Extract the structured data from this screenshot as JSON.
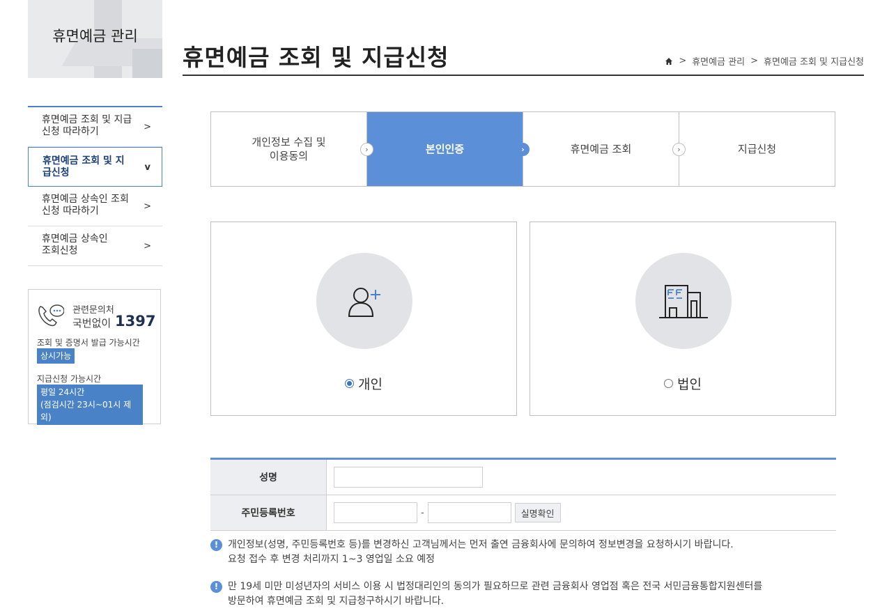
{
  "sidebar": {
    "title": "휴면예금 관리",
    "items": [
      {
        "label": "휴면예금 조회 및 지급신청 따라하기",
        "arrow": ">"
      },
      {
        "label": "휴면예금 조회 및 지급신청",
        "arrow": "v"
      },
      {
        "label": "휴면예금 상속인 조회신청 따라하기",
        "arrow": ">"
      },
      {
        "label": "휴면예금 상속인 조회신청",
        "arrow": ">"
      }
    ],
    "contact": {
      "label": "관련문의처",
      "prefix": "국번없이",
      "number": "1397",
      "hours1_label": "조회 및 증명서 발급 가능시간",
      "hours1_badge": "상시가능",
      "hours2_label": "지급신청 가능시간",
      "hours2_badge_line1": "평일 24시간",
      "hours2_badge_line2": "(점검시간 23시~01시 제외)"
    }
  },
  "header": {
    "title": "휴면예금 조회 및 지급신청",
    "breadcrumb": [
      "휴면예금 관리",
      "휴면예금 조회 및 지급신청"
    ],
    "separator": ">"
  },
  "steps": [
    {
      "line1": "개인정보 수집 및",
      "line2": "이용동의",
      "active": false
    },
    {
      "line1": "본인인증",
      "line2": "",
      "active": true
    },
    {
      "line1": "휴면예금 조회",
      "line2": "",
      "active": false
    },
    {
      "line1": "지급신청",
      "line2": "",
      "active": false
    }
  ],
  "types": {
    "individual": {
      "label": "개인",
      "selected": true,
      "icon": "person-add-icon"
    },
    "corporate": {
      "label": "법인",
      "selected": false,
      "icon": "building-icon"
    }
  },
  "form": {
    "name_label": "성명",
    "name_value": "",
    "rrn_label": "주민등록번호",
    "rrn_front": "",
    "rrn_separator": "-",
    "rrn_back": "",
    "verify_button": "실명확인"
  },
  "notices": [
    {
      "line1": "개인정보(성명, 주민등록번호 등)를 변경하신 고객님께서는 먼저 출연 금융회사에 문의하여 정보변경을 요청하시기 바랍니다.",
      "line2": "요청 접수 후 변경 처리까지 1~3 영업일 소요 예정"
    },
    {
      "line1": "만 19세 미만 미성년자의 서비스 이용 시 법정대리인의 동의가 필요하므로 관련 금융회사 영업점 혹은 전국 서민금융통합지원센터를",
      "line2": "방문하여 휴면예금 조회 및 지급청구하시기 바랍니다."
    }
  ],
  "colors": {
    "accent": "#5b8fd8",
    "title_bar": "#333333"
  }
}
